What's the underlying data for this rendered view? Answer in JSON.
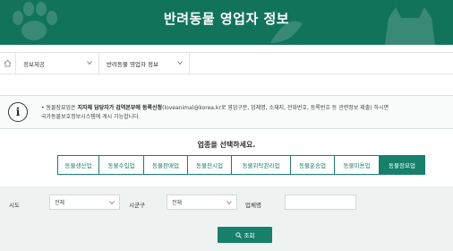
{
  "header": {
    "title": "반려동물 영업자 정보"
  },
  "breadcrumb": {
    "home_icon": "home-icon",
    "items": [
      {
        "label": "정보제공"
      },
      {
        "label": "반려동물 영업자 정보"
      }
    ]
  },
  "notice": {
    "icon": "info-icon",
    "info_glyph": "i",
    "prefix": "• 동물장묘업은 ",
    "bold": "지자체 담당자가 검역본부에 등록신청",
    "suffix": "(loveanimal@korea.kr로 영업구분, 업체명, 소재지, 전화번호, 등록번호 등 관련정보 제출) 하시면",
    "line2": "국가동물보호정보시스템에 게시 가능합니다."
  },
  "business_type": {
    "title": "업종을 선택하세요.",
    "tabs": [
      {
        "label": "동물생산업"
      },
      {
        "label": "동물수입업"
      },
      {
        "label": "동물판매업"
      },
      {
        "label": "동물전시업"
      },
      {
        "label": "동물위탁관리업"
      },
      {
        "label": "동물운송업"
      },
      {
        "label": "동물미용업"
      },
      {
        "label": "동물장묘업"
      }
    ],
    "active_tab": "동물장묘업"
  },
  "filters": {
    "sido_label": "시도",
    "sido_value": "전체",
    "sigungu_label": "시군구",
    "sigungu_value": "전체",
    "company_label": "업체명",
    "company_value": ""
  },
  "search_button": {
    "label": "조회",
    "icon": "search-icon"
  },
  "colors": {
    "banner": "#12735b",
    "accent": "#17806a",
    "filter_bg": "#eef3f1"
  }
}
